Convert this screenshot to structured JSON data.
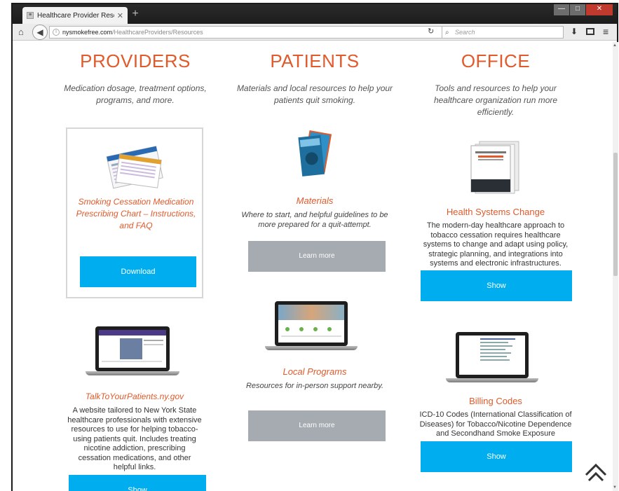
{
  "browser": {
    "tab_title": "Healthcare Provider Resour...",
    "tab_close": "✕",
    "new_tab": "+",
    "url_host": "nysmokefree.com",
    "url_path": "/HealthcareProviders/Resources",
    "search_placeholder": "Search"
  },
  "columns": {
    "providers": {
      "heading": "PROVIDERS",
      "intro": "Medication dosage, treatment options, programs, and more.",
      "card1": {
        "title": "Smoking Cessation Medication Prescribing Chart – Instructions, and FAQ",
        "button": "Download"
      },
      "card2": {
        "title": "TalkToYourPatients.ny.gov",
        "body": "A website tailored to New York State healthcare professionals with extensive resources to use for helping tobacco-using patients quit. Includes treating nicotine addiction, prescribing cessation medications, and other helpful links.",
        "button": "Show"
      }
    },
    "patients": {
      "heading": "PATIENTS",
      "intro": "Materials and local resources to help your patients quit smoking.",
      "card1": {
        "title": "Materials",
        "body": "Where to start, and helpful guidelines to be more prepared for a quit-attempt.",
        "button": "Learn more"
      },
      "card2": {
        "title": "Local Programs",
        "body": "Resources for in-person support nearby.",
        "button": "Learn more"
      }
    },
    "office": {
      "heading": "OFFICE",
      "intro": "Tools and resources to help your healthcare organization run more efficiently.",
      "card1": {
        "title": "Health Systems Change",
        "body": "The modern-day healthcare approach to tobacco cessation requires healthcare systems to change and adapt using policy, strategic planning, and integrations into systems and electronic infrastructures.",
        "button": "Show"
      },
      "card2": {
        "title": "Billing Codes",
        "body": "ICD-10 Codes (International Classification of Diseases) for Tobacco/Nicotine Dependence and Secondhand Smoke Exposure",
        "button": "Show"
      }
    }
  },
  "colors": {
    "accent_orange": "#e05a2b",
    "button_blue": "#00aeef",
    "button_gray": "#a5abb1"
  }
}
